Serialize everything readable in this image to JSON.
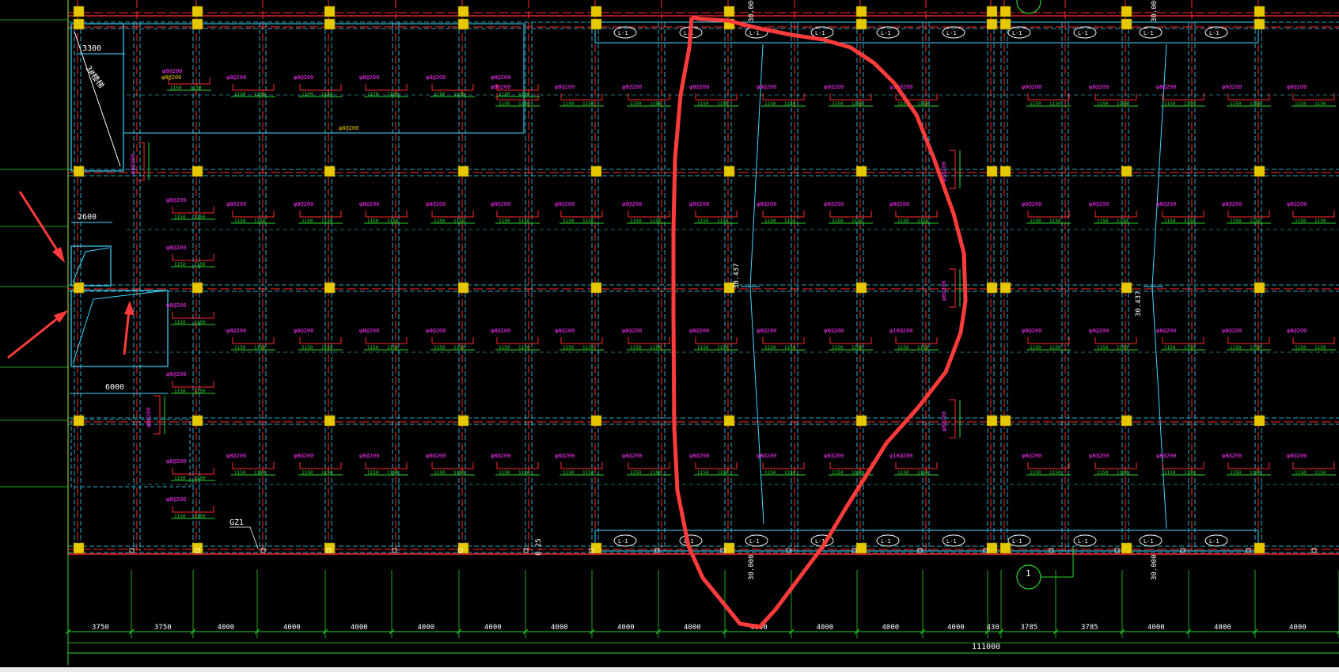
{
  "drawing": {
    "dimensions_bottom": [
      "3750",
      "3750",
      "4000",
      "4000",
      "4000",
      "4000",
      "4000",
      "4000",
      "4000",
      "4000",
      "4000",
      "4000",
      "4000",
      "4000",
      "430",
      "3785",
      "3785",
      "4000",
      "4000",
      "4000"
    ],
    "total_length": "111000",
    "left_dims": {
      "top_width": "3300",
      "mid_width": "2600",
      "low_width": "6000"
    },
    "stair_label": "3#楼梯",
    "column_label": "GZ1",
    "elevations": {
      "top_a": "30.000",
      "top_b": "30.000",
      "bottom_a": "30.000",
      "bottom_b": "30.000",
      "slope_a": "30.437",
      "slope_b": "30.437",
      "small": "0.25"
    },
    "rebar_label": "φ8@200",
    "rebar_label_alt": "φ10@200",
    "dim_pair": [
      "1150",
      "1150"
    ],
    "beam_tag": "L-1",
    "section_mark": "1"
  },
  "colors": {
    "background": "#000000",
    "grid_red": "#ff2a2a",
    "cyan": "#3fd7ff",
    "green": "#2bd42b",
    "magenta": "#ff33ff",
    "yellow_column": "#e6c800",
    "white": "#ffffff",
    "annotation_red": "#ff3b3b"
  }
}
